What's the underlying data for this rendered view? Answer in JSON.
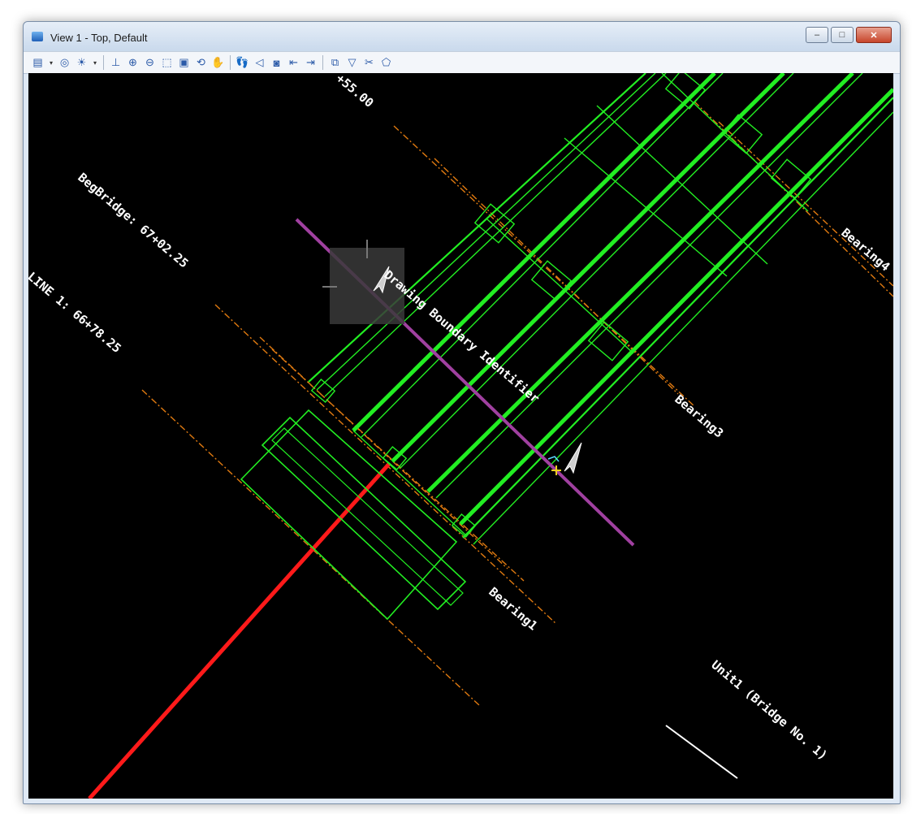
{
  "window": {
    "title": "View 1 - Top, Default",
    "controls": {
      "minimize": "–",
      "maximize": "□",
      "close": "✕"
    }
  },
  "toolbar": {
    "items": [
      {
        "name": "view-attributes-icon",
        "glyph": "▤"
      },
      {
        "name": "dropdown-arrow-icon",
        "glyph": "▾"
      },
      {
        "name": "display-style-icon",
        "glyph": "◎"
      },
      {
        "name": "lighting-icon",
        "glyph": "☀"
      },
      {
        "name": "dropdown-arrow-icon",
        "glyph": "▾"
      },
      {
        "name": "separator",
        "glyph": ""
      },
      {
        "name": "update-view-icon",
        "glyph": "⊥"
      },
      {
        "name": "zoom-in-icon",
        "glyph": "⊕"
      },
      {
        "name": "zoom-out-icon",
        "glyph": "⊖"
      },
      {
        "name": "window-area-icon",
        "glyph": "⬚"
      },
      {
        "name": "fit-view-icon",
        "glyph": "▣"
      },
      {
        "name": "rotate-view-icon",
        "glyph": "⟲"
      },
      {
        "name": "pan-view-icon",
        "glyph": "✋"
      },
      {
        "name": "separator",
        "glyph": ""
      },
      {
        "name": "walk-icon",
        "glyph": "👣"
      },
      {
        "name": "view-previous-icon",
        "glyph": "◁"
      },
      {
        "name": "camera-icon",
        "glyph": "◙"
      },
      {
        "name": "previous-view-icon",
        "glyph": "⇤"
      },
      {
        "name": "next-view-icon",
        "glyph": "⇥"
      },
      {
        "name": "separator",
        "glyph": ""
      },
      {
        "name": "copy-view-icon",
        "glyph": "⧉"
      },
      {
        "name": "clip-volume-icon",
        "glyph": "▽"
      },
      {
        "name": "clip-mask-icon",
        "glyph": "✂"
      },
      {
        "name": "clip-fence-icon",
        "glyph": "⬠"
      }
    ]
  },
  "drawing": {
    "labels": {
      "station_top": "+55.00",
      "beg_bridge": "BegBridge: 67+02.25",
      "line1": "LINE 1: 66+78.25",
      "drawing_boundary": "Drawing Boundary Identifier",
      "bearing1": "Bearing1",
      "bearing3": "Bearing3",
      "bearing4": "Bearing4",
      "unit1": "Unit1 (Bridge No. 1)"
    },
    "colors": {
      "background": "#000000",
      "girders": "#22ee22",
      "alignment": "#ff1a1a",
      "bearing_lines": "#e07a10",
      "boundary": "#a040a0",
      "text": "#ffffff"
    }
  }
}
